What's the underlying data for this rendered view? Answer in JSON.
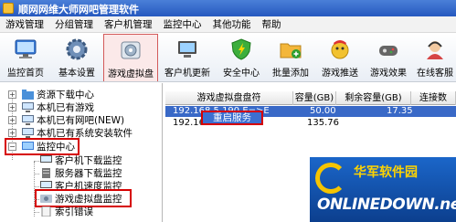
{
  "window": {
    "title": "顺网网维大师网吧管理软件"
  },
  "menu": [
    "游戏管理",
    "分组管理",
    "客户机管理",
    "监控中心",
    "其他功能",
    "帮助"
  ],
  "toolbar": {
    "buttons": [
      {
        "label": "监控首页",
        "icon": "monitor-home-icon"
      },
      {
        "label": "基本设置",
        "icon": "gear-icon"
      },
      {
        "label": "游戏虚拟盘",
        "icon": "virtual-disk-icon"
      },
      {
        "label": "客户机更新",
        "icon": "client-update-icon"
      },
      {
        "label": "安全中心",
        "icon": "shield-icon"
      },
      {
        "label": "批量添加",
        "icon": "batch-add-icon"
      },
      {
        "label": "游戏推送",
        "icon": "game-push-icon"
      },
      {
        "label": "游戏效果",
        "icon": "game-effect-icon"
      },
      {
        "label": "在线客服",
        "icon": "online-service-icon"
      }
    ]
  },
  "tree": {
    "items": [
      "资源下载中心",
      "本机已有游戏",
      "本机已有网吧(NEW)",
      "本机已有系统安装软件",
      "监控中心",
      "客户机下载监控",
      "服务器下载监控",
      "客户机速度监控",
      "游戏虚拟盘监控",
      "索引错误"
    ]
  },
  "grid": {
    "columns": [
      "游戏虚拟盘盘符",
      "容量(GB)",
      "剩余容量(GB)",
      "连接数"
    ],
    "rows": [
      {
        "drive": "192.168.5.190 E=>E",
        "capacity": "50.00",
        "free": "17.35",
        "connections": ""
      },
      {
        "drive": "192.168.5.19 E=>E",
        "capacity": "135.76",
        "free": "",
        "connections": ""
      }
    ]
  },
  "context_menu": {
    "label": "重启服务"
  },
  "watermark": {
    "cn": "华军软件园",
    "en": "ONLINEDOWN.net"
  }
}
